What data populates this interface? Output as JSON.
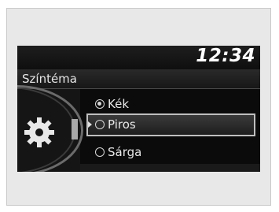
{
  "status_bar": {
    "clock": "12:34"
  },
  "menu": {
    "title": "Színtéma",
    "options": [
      {
        "label": "Kék",
        "selected": true,
        "highlighted": false
      },
      {
        "label": "Piros",
        "selected": false,
        "highlighted": true
      },
      {
        "label": "Sárga",
        "selected": false,
        "highlighted": false
      }
    ]
  },
  "icons": {
    "settings": "gear-icon"
  }
}
